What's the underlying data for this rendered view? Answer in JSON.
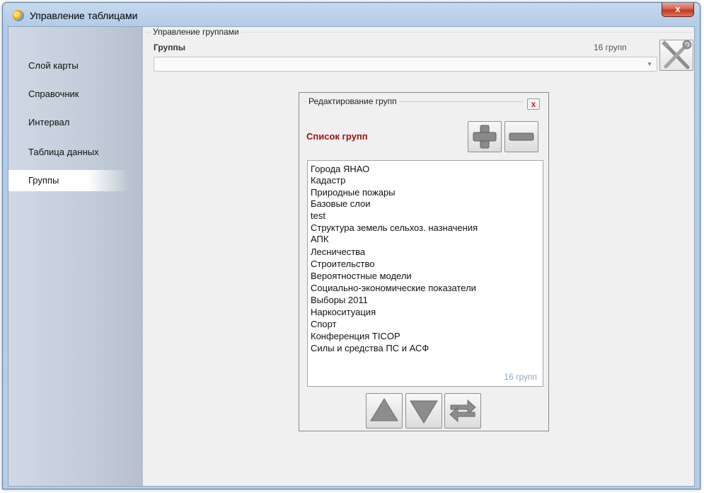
{
  "window": {
    "title": "Управление таблицами",
    "close_label": "x"
  },
  "sidebar": {
    "items": [
      {
        "label": "Слой карты"
      },
      {
        "label": "Справочник"
      },
      {
        "label": "Интервал"
      },
      {
        "label": "Таблица данных"
      },
      {
        "label": "Группы"
      }
    ],
    "selected_index": 4
  },
  "main": {
    "section_title": "Управление группами",
    "groups_label": "Группы",
    "groups_count": "16 групп",
    "combo_value": ""
  },
  "editor": {
    "title": "Редактирование групп",
    "close_label": "x",
    "list_header": "Список групп",
    "items": [
      "Города ЯНАО",
      "Кадастр",
      "Природные пожары",
      "Базовые слои",
      "test",
      "Структура земель сельхоз. назначения",
      "АПК",
      "Лесничества",
      "Строительство",
      "Вероятностные модели",
      "Социально-экономические показатели",
      "Выборы 2011",
      "Наркоситуация",
      "Спорт",
      "Конференция TICOP",
      "Силы и средства ПС и АСФ"
    ],
    "items_count": "16 групп"
  },
  "colors": {
    "list_header": "#9e1010",
    "count_text": "#8aa6c4",
    "close_button": "#c1391f"
  },
  "icons": {
    "tools": "tools-icon",
    "add": "plus-icon",
    "remove": "minus-icon",
    "up": "arrow-up-icon",
    "down": "arrow-down-icon",
    "refresh": "refresh-icon"
  }
}
